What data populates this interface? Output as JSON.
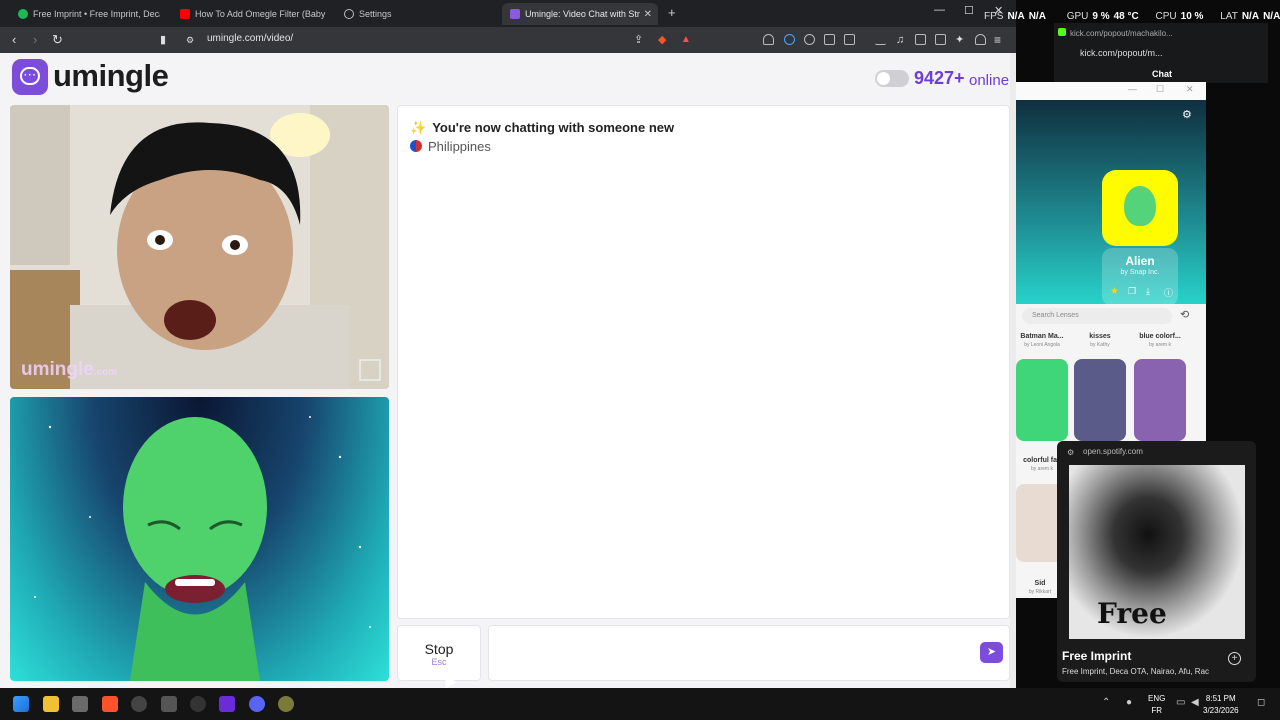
{
  "browser": {
    "tabs": [
      {
        "label": "Free Imprint • Free Imprint, Deca",
        "color": "#1db954"
      },
      {
        "label": "How To Add Omegle Filter (Baby Fac",
        "color": "#ff0000"
      },
      {
        "label": "Settings",
        "color": "#999999"
      },
      {
        "label": "Umingle: Video Chat with Str",
        "color": "#8a5ae0"
      }
    ],
    "new_tab": "+",
    "url": "umingle.com/video/"
  },
  "page": {
    "logo_text": "umingle",
    "online_count": "9427+",
    "online_label": "online",
    "video_watermark": "umingle",
    "video_watermark_suffix": ".com",
    "chat": {
      "message_new": "You're now chatting with someone new",
      "country": "Philippines"
    },
    "stop_label": "Stop",
    "stop_shortcut": "Esc",
    "message_placeholder": ""
  },
  "overlay_stats": {
    "fps_label": "FPS",
    "fps_value": "N/A",
    "extra_value": "N/A",
    "gpu_label": "GPU",
    "gpu_value": "9 %",
    "gpu_temp": "48 °C",
    "cpu_label": "CPU",
    "cpu_value": "10 %",
    "lat_label": "LAT",
    "lat_value": "N/A",
    "lat_value2": "N/A"
  },
  "kick": {
    "tab_url": "kick.com/popout/machakilo...",
    "address": "kick.com/popout/m...",
    "chat_label": "Chat"
  },
  "snap": {
    "lens_name": "Alien",
    "lens_by": "by Snap Inc.",
    "search_placeholder": "Search Lenses",
    "lenses": [
      {
        "name": "Batman Ma...",
        "by": "by Leoni Angola"
      },
      {
        "name": "kisses",
        "by": "by Kathy"
      },
      {
        "name": "blue colorf...",
        "by": "by arem k"
      },
      {
        "name": "colorful fac",
        "by": "by arem k"
      },
      {
        "name": "Sid",
        "by": "by Rikkart"
      }
    ]
  },
  "spotify": {
    "url": "open.spotify.com",
    "title": "Free Imprint",
    "artists": "Free Imprint, Deca OTA, Nairao, Afu, Rac",
    "art_text": "Free"
  },
  "taskbar": {
    "lang_1": "ENG",
    "lang_2": "FR",
    "time": "8:51 PM",
    "date": "3/23/2026"
  }
}
